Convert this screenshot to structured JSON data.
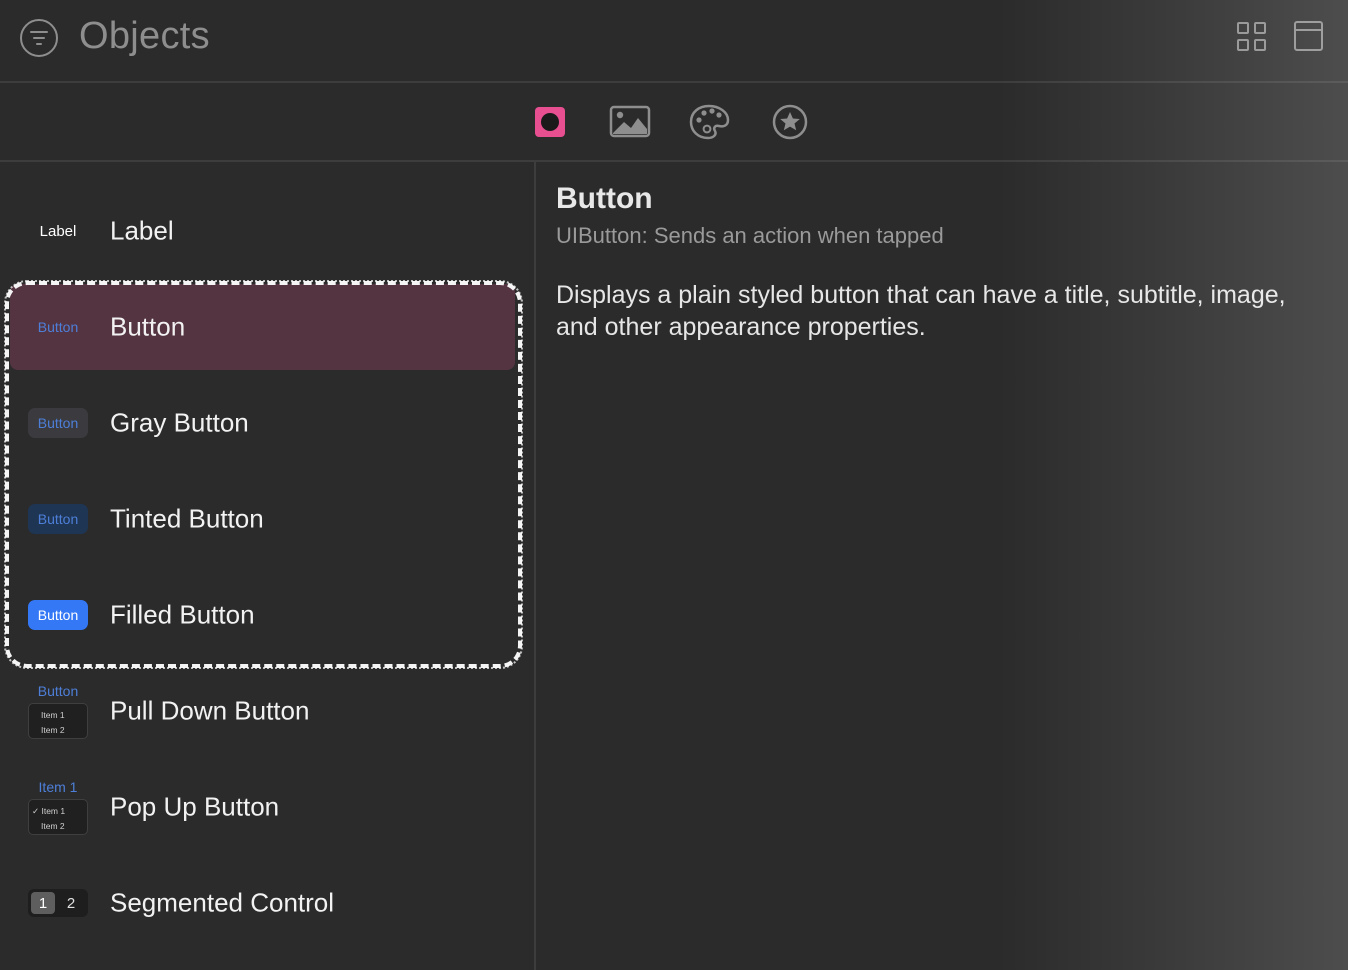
{
  "header": {
    "title": "Objects"
  },
  "categories": [
    {
      "name": "controls",
      "icon": "record-icon",
      "selected": true
    },
    {
      "name": "media",
      "icon": "image-icon",
      "selected": false
    },
    {
      "name": "colors",
      "icon": "palette-icon",
      "selected": false
    },
    {
      "name": "symbols",
      "icon": "star-circle-icon",
      "selected": false
    }
  ],
  "colors": {
    "accent": "#e84f91",
    "selection": "#553442",
    "link_blue": "#4d7fd9",
    "filled_blue": "#3578f6"
  },
  "list": [
    {
      "name": "Label",
      "thumb": "Label"
    },
    {
      "name": "Button",
      "thumb": "Button",
      "selected": true
    },
    {
      "name": "Gray Button",
      "thumb": "Button"
    },
    {
      "name": "Tinted Button",
      "thumb": "Button"
    },
    {
      "name": "Filled Button",
      "thumb": "Button"
    },
    {
      "name": "Pull Down Button",
      "thumb": "Button",
      "menu": [
        "Item 1",
        "Item 2"
      ]
    },
    {
      "name": "Pop Up Button",
      "thumb": "Item 1",
      "menu": [
        "✓ Item 1",
        "Item 2"
      ]
    },
    {
      "name": "Segmented Control",
      "segments": [
        "1",
        "2"
      ]
    }
  ],
  "detail": {
    "title": "Button",
    "subtitle": "UIButton: Sends an action when tapped",
    "description": "Displays a plain styled button that can have a title, subtitle, image, and other appearance properties."
  }
}
